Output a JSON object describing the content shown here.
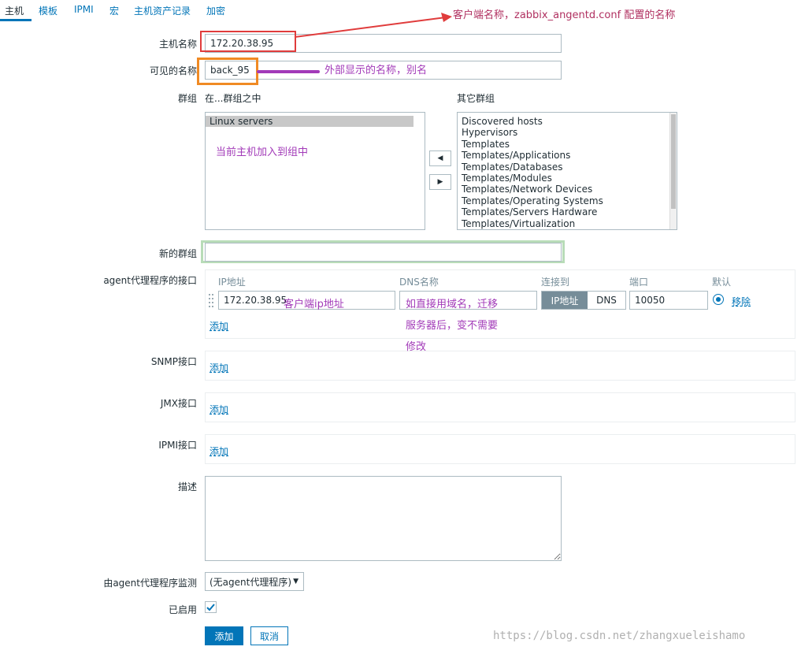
{
  "tabs": [
    {
      "label": "主机"
    },
    {
      "label": "模板"
    },
    {
      "label": "IPMI"
    },
    {
      "label": "宏"
    },
    {
      "label": "主机资产记录"
    },
    {
      "label": "加密"
    }
  ],
  "form": {
    "host_name_label": "主机名称",
    "host_name_value": "172.20.38.95",
    "visible_name_label": "可见的名称",
    "visible_name_value": "back_95",
    "groups_label": "群组",
    "in_groups_label": "在...群组之中",
    "other_groups_label": "其它群组",
    "in_groups": [
      "Linux servers"
    ],
    "other_groups": [
      "Discovered hosts",
      "Hypervisors",
      "Templates",
      "Templates/Applications",
      "Templates/Databases",
      "Templates/Modules",
      "Templates/Network Devices",
      "Templates/Operating Systems",
      "Templates/Servers Hardware",
      "Templates/Virtualization"
    ],
    "move_left_glyph": "◀",
    "move_right_glyph": "▶",
    "new_group_label": "新的群组",
    "new_group_value": "",
    "agent_interface_label": "agent代理程序的接口",
    "interface_headers": {
      "ip": "IP地址",
      "dns": "DNS名称",
      "connect_to": "连接到",
      "port": "端口",
      "default": "默认"
    },
    "agent_interface": {
      "ip": "172.20.38.95",
      "dns": "",
      "connect_ip_label": "IP地址",
      "connect_dns_label": "DNS",
      "port": "10050",
      "remove_label": "移除"
    },
    "add_label": "添加",
    "snmp_label": "SNMP接口",
    "jmx_label": "JMX接口",
    "ipmi_label": "IPMI接口",
    "description_label": "描述",
    "description_value": "",
    "proxy_label": "由agent代理程序监测",
    "proxy_value": "(无agent代理程序)",
    "enabled_label": "已启用",
    "enabled_checked": true,
    "submit_label": "添加",
    "cancel_label": "取消"
  },
  "annotations": {
    "host_name_note": "客户端名称，zabbix_angentd.conf 配置的名称",
    "visible_name_note": "外部显示的名称，别名",
    "group_note": "当前主机加入到组中",
    "ip_note": "客户端ip地址",
    "dns_note_line1": "如直接用域名，迁移",
    "dns_note_line2": "服务器后，变不需要",
    "dns_note_line3": "修改"
  },
  "watermark": "https://blog.csdn.net/zhangxueleishamo",
  "colors": {
    "accent": "#0275b8",
    "annotation_red": "#e03c3c",
    "annotation_orange": "#f08a24",
    "annotation_purple": "#a23ab8",
    "annotation_green": "#b8dcb8"
  }
}
